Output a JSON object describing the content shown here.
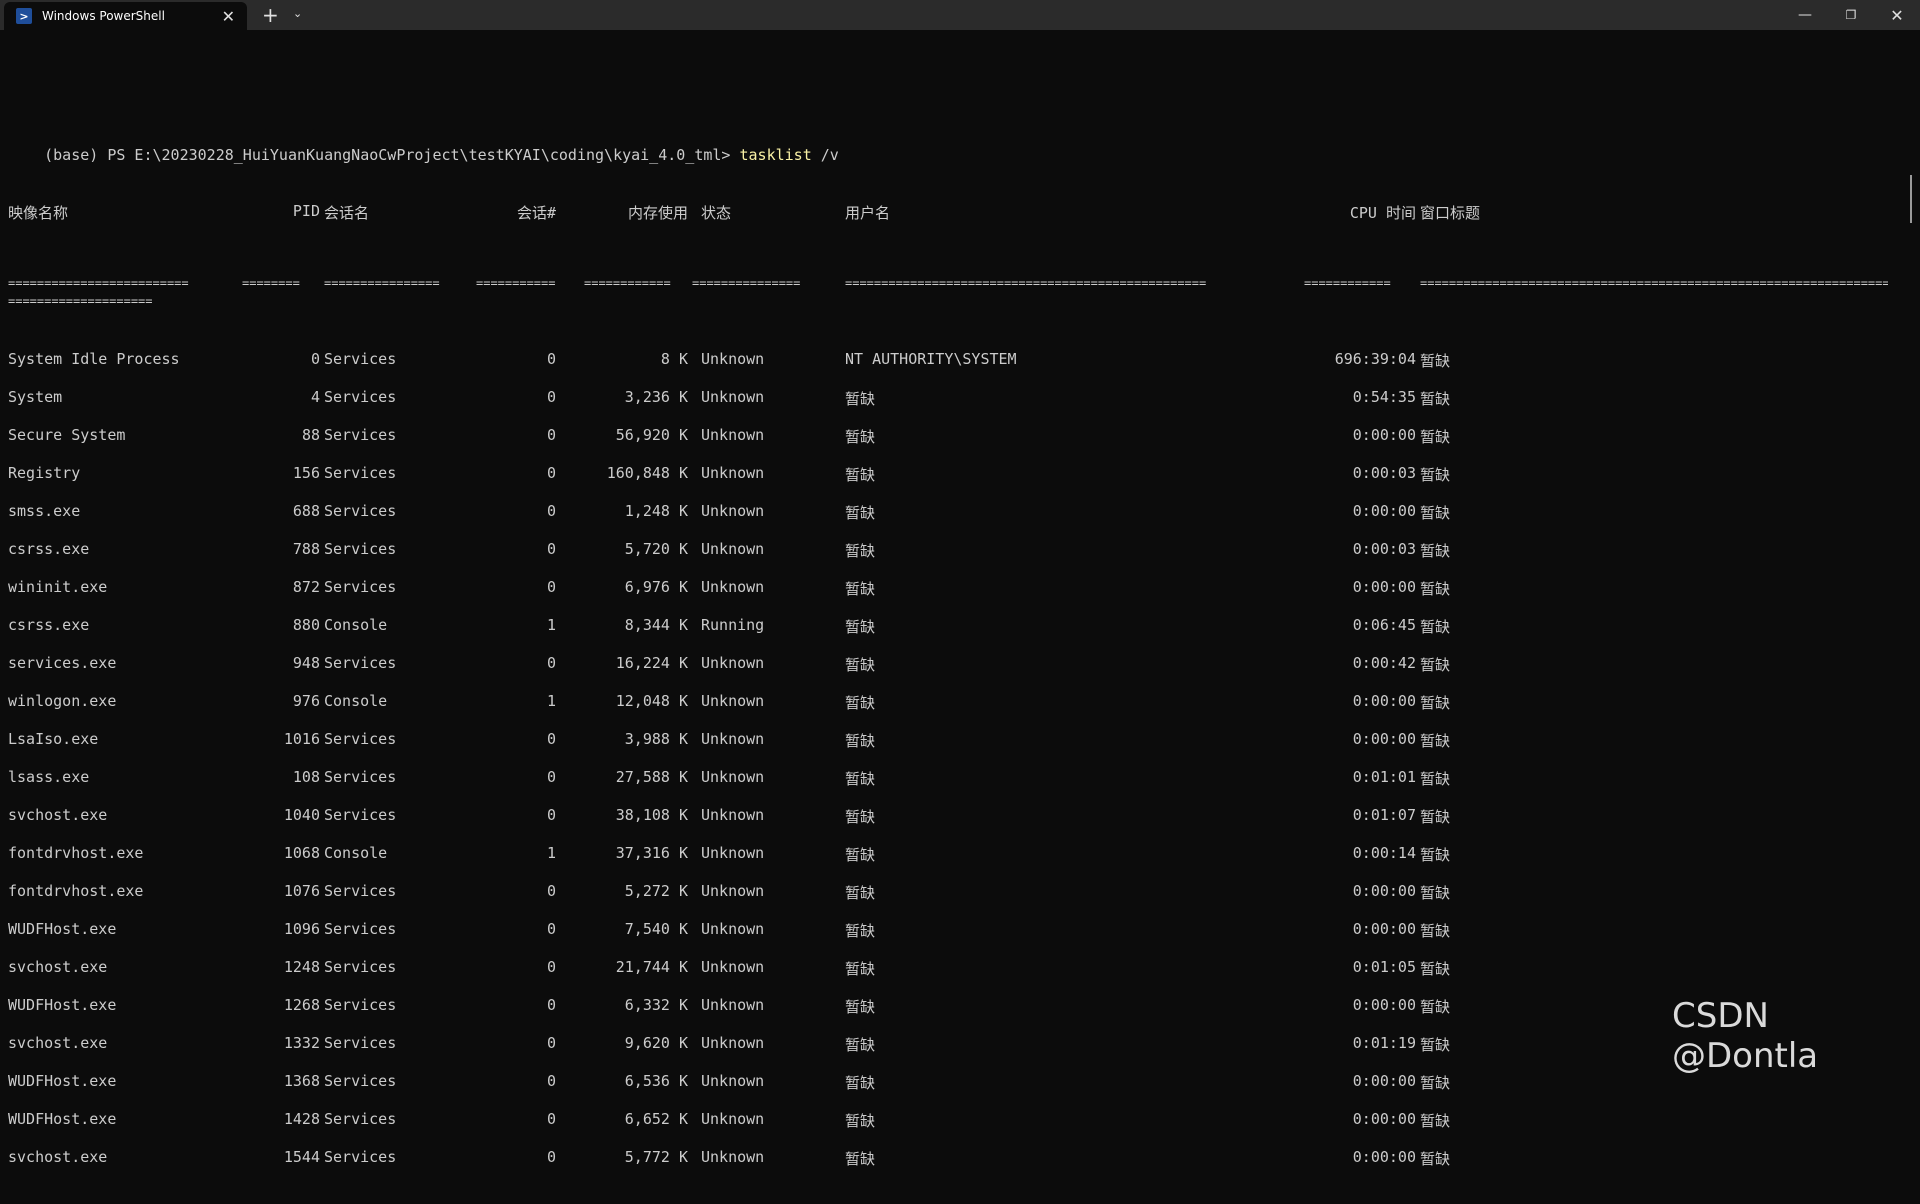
{
  "window": {
    "tab_title": "Windows PowerShell",
    "tab_icon": "powershell-icon",
    "close_tab": "✕",
    "new_tab": "+",
    "dropdown": "⌄",
    "minimize": "—",
    "maximize": "❐",
    "close": "✕"
  },
  "terminal": {
    "prompt": "(base) PS E:\\20230228_HuiYuanKuangNaoCwProject\\testKYAI\\coding\\kyai_4.0_tml>",
    "command": "tasklist",
    "args": " /v",
    "headers": {
      "image": "映像名称",
      "pid": "PID",
      "session_name": "会话名",
      "session_num": "会话#",
      "mem": "内存使用",
      "status": "状态",
      "user": "用户名",
      "cpu": "CPU 时间",
      "window_title": "窗口标题"
    },
    "separators": {
      "image": "=========================",
      "pid": "========",
      "session_name": "================",
      "session_num": "===========",
      "mem": "============",
      "status": "===============",
      "user": "==================================================",
      "cpu": "============",
      "window_title": "========================================================================",
      "wrap": "===================="
    },
    "rows": [
      {
        "image": "System Idle Process",
        "pid": "0",
        "session_name": "Services",
        "session_num": "0",
        "mem": "8 K",
        "status": "Unknown",
        "user": "NT AUTHORITY\\SYSTEM",
        "cpu": "696:39:04",
        "title": "暂缺"
      },
      {
        "image": "System",
        "pid": "4",
        "session_name": "Services",
        "session_num": "0",
        "mem": "3,236 K",
        "status": "Unknown",
        "user": "暂缺",
        "cpu": "0:54:35",
        "title": "暂缺"
      },
      {
        "image": "Secure System",
        "pid": "88",
        "session_name": "Services",
        "session_num": "0",
        "mem": "56,920 K",
        "status": "Unknown",
        "user": "暂缺",
        "cpu": "0:00:00",
        "title": "暂缺"
      },
      {
        "image": "Registry",
        "pid": "156",
        "session_name": "Services",
        "session_num": "0",
        "mem": "160,848 K",
        "status": "Unknown",
        "user": "暂缺",
        "cpu": "0:00:03",
        "title": "暂缺"
      },
      {
        "image": "smss.exe",
        "pid": "688",
        "session_name": "Services",
        "session_num": "0",
        "mem": "1,248 K",
        "status": "Unknown",
        "user": "暂缺",
        "cpu": "0:00:00",
        "title": "暂缺"
      },
      {
        "image": "csrss.exe",
        "pid": "788",
        "session_name": "Services",
        "session_num": "0",
        "mem": "5,720 K",
        "status": "Unknown",
        "user": "暂缺",
        "cpu": "0:00:03",
        "title": "暂缺"
      },
      {
        "image": "wininit.exe",
        "pid": "872",
        "session_name": "Services",
        "session_num": "0",
        "mem": "6,976 K",
        "status": "Unknown",
        "user": "暂缺",
        "cpu": "0:00:00",
        "title": "暂缺"
      },
      {
        "image": "csrss.exe",
        "pid": "880",
        "session_name": "Console",
        "session_num": "1",
        "mem": "8,344 K",
        "status": "Running",
        "user": "暂缺",
        "cpu": "0:06:45",
        "title": "暂缺"
      },
      {
        "image": "services.exe",
        "pid": "948",
        "session_name": "Services",
        "session_num": "0",
        "mem": "16,224 K",
        "status": "Unknown",
        "user": "暂缺",
        "cpu": "0:00:42",
        "title": "暂缺"
      },
      {
        "image": "winlogon.exe",
        "pid": "976",
        "session_name": "Console",
        "session_num": "1",
        "mem": "12,048 K",
        "status": "Unknown",
        "user": "暂缺",
        "cpu": "0:00:00",
        "title": "暂缺"
      },
      {
        "image": "LsaIso.exe",
        "pid": "1016",
        "session_name": "Services",
        "session_num": "0",
        "mem": "3,988 K",
        "status": "Unknown",
        "user": "暂缺",
        "cpu": "0:00:00",
        "title": "暂缺"
      },
      {
        "image": "lsass.exe",
        "pid": "108",
        "session_name": "Services",
        "session_num": "0",
        "mem": "27,588 K",
        "status": "Unknown",
        "user": "暂缺",
        "cpu": "0:01:01",
        "title": "暂缺"
      },
      {
        "image": "svchost.exe",
        "pid": "1040",
        "session_name": "Services",
        "session_num": "0",
        "mem": "38,108 K",
        "status": "Unknown",
        "user": "暂缺",
        "cpu": "0:01:07",
        "title": "暂缺"
      },
      {
        "image": "fontdrvhost.exe",
        "pid": "1068",
        "session_name": "Console",
        "session_num": "1",
        "mem": "37,316 K",
        "status": "Unknown",
        "user": "暂缺",
        "cpu": "0:00:14",
        "title": "暂缺"
      },
      {
        "image": "fontdrvhost.exe",
        "pid": "1076",
        "session_name": "Services",
        "session_num": "0",
        "mem": "5,272 K",
        "status": "Unknown",
        "user": "暂缺",
        "cpu": "0:00:00",
        "title": "暂缺"
      },
      {
        "image": "WUDFHost.exe",
        "pid": "1096",
        "session_name": "Services",
        "session_num": "0",
        "mem": "7,540 K",
        "status": "Unknown",
        "user": "暂缺",
        "cpu": "0:00:00",
        "title": "暂缺"
      },
      {
        "image": "svchost.exe",
        "pid": "1248",
        "session_name": "Services",
        "session_num": "0",
        "mem": "21,744 K",
        "status": "Unknown",
        "user": "暂缺",
        "cpu": "0:01:05",
        "title": "暂缺"
      },
      {
        "image": "WUDFHost.exe",
        "pid": "1268",
        "session_name": "Services",
        "session_num": "0",
        "mem": "6,332 K",
        "status": "Unknown",
        "user": "暂缺",
        "cpu": "0:00:00",
        "title": "暂缺"
      },
      {
        "image": "svchost.exe",
        "pid": "1332",
        "session_name": "Services",
        "session_num": "0",
        "mem": "9,620 K",
        "status": "Unknown",
        "user": "暂缺",
        "cpu": "0:01:19",
        "title": "暂缺"
      },
      {
        "image": "WUDFHost.exe",
        "pid": "1368",
        "session_name": "Services",
        "session_num": "0",
        "mem": "6,536 K",
        "status": "Unknown",
        "user": "暂缺",
        "cpu": "0:00:00",
        "title": "暂缺"
      },
      {
        "image": "WUDFHost.exe",
        "pid": "1428",
        "session_name": "Services",
        "session_num": "0",
        "mem": "6,652 K",
        "status": "Unknown",
        "user": "暂缺",
        "cpu": "0:00:00",
        "title": "暂缺"
      },
      {
        "image": "svchost.exe",
        "pid": "1544",
        "session_name": "Services",
        "session_num": "0",
        "mem": "5,772 K",
        "status": "Unknown",
        "user": "暂缺",
        "cpu": "0:00:00",
        "title": "暂缺"
      }
    ]
  },
  "watermark": "CSDN @Dontla"
}
